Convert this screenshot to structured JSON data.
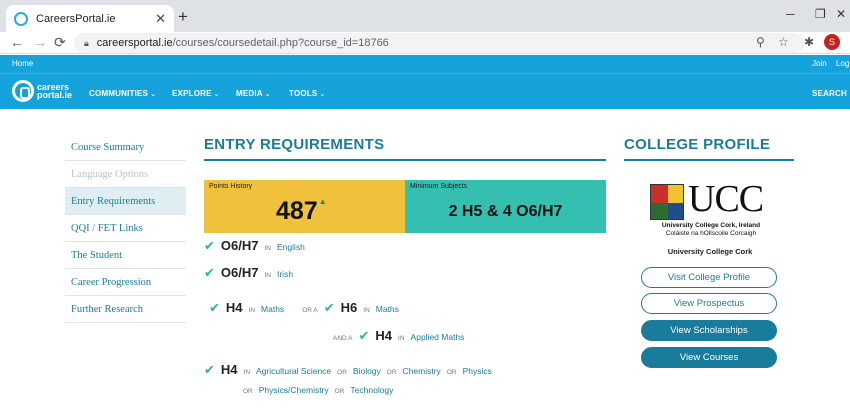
{
  "browser": {
    "tab_title": "CareersPortal.ie",
    "tab_close": "✕",
    "new_tab": "+",
    "url_host": "careersportal.ie",
    "url_path": "/courses/coursedetail.php?course_id=18766",
    "avatar_letter": "S",
    "controls": {
      "minimize": "─",
      "restore": "❐",
      "close": "✕"
    },
    "nav": {
      "back": "←",
      "forward": "→",
      "reload": "⟳"
    },
    "icons": {
      "zoom": "⚲",
      "bookmark": "☆",
      "extensions": "✱"
    }
  },
  "topstrip": {
    "home": "Home",
    "join": "Join",
    "login": "Log"
  },
  "site_nav": {
    "logo_line1": "careers",
    "logo_line2": "portal.ie",
    "items": [
      {
        "label": "COMMUNITIES"
      },
      {
        "label": "EXPLORE"
      },
      {
        "label": "MEDIA"
      },
      {
        "label": "TOOLS"
      }
    ],
    "search_label": "SEARCH"
  },
  "sidebar": {
    "items": [
      {
        "label": "Course Summary",
        "state": "normal"
      },
      {
        "label": "Language Options",
        "state": "disabled"
      },
      {
        "label": "Entry Requirements",
        "state": "active"
      },
      {
        "label": "QQI / FET Links",
        "state": "normal"
      },
      {
        "label": "The Student",
        "state": "normal"
      },
      {
        "label": "Career Progression",
        "state": "normal"
      },
      {
        "label": "Further Research",
        "state": "normal"
      }
    ]
  },
  "entry": {
    "heading": "ENTRY REQUIREMENTS",
    "points_label": "Points History",
    "points_value": "487",
    "points_trend": "▲",
    "min_label": "Minimum Subjects",
    "min_value": "2 H5 & 4 O6/H7",
    "in_word": "IN",
    "or_word": "OR",
    "or_a": "OR A",
    "and_a": "AND A",
    "req1": {
      "grade": "O6/H7",
      "subject": "English"
    },
    "req2": {
      "grade": "O6/H7",
      "subject": "Irish"
    },
    "req3": {
      "grade": "H4",
      "subject": "Maths",
      "grade_b": "H6",
      "subject_b": "Maths"
    },
    "req4": {
      "grade": "H4",
      "subject": "Applied Maths"
    },
    "req5": {
      "grade": "H4",
      "subjects": [
        "Agricultural Science",
        "Biology",
        "Chemistry",
        "Physics",
        "Physics/Chemistry",
        "Technology"
      ]
    }
  },
  "college": {
    "heading": "COLLEGE PROFILE",
    "logo_text": "UCC",
    "logo_line1": "University College Cork, Ireland",
    "logo_line2": "Coláiste na hOllscoile Corcaigh",
    "name": "University College Cork",
    "buttons": {
      "visit": "Visit College Profile",
      "prospectus": "View Prospectus",
      "scholarships": "View Scholarships",
      "courses": "View Courses"
    }
  }
}
